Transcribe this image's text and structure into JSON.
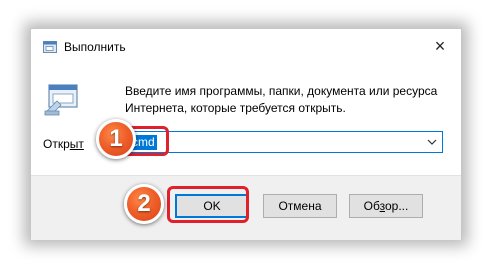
{
  "window": {
    "title": "Выполнить",
    "icon": "run-icon",
    "close_icon": "close-icon",
    "close_glyph": "×"
  },
  "body": {
    "icon": "run-dialog-icon",
    "description_line1": "Введите имя программы, папки, документа или ресурса",
    "description_line2": "Интернета, которые требуется открыть.",
    "open_label_prefix": "Откр",
    "open_label_rest": "ыт",
    "open_input": {
      "value": "cmd",
      "dropdown_icon": "chevron-down-icon"
    }
  },
  "buttons": {
    "ok": "OK",
    "cancel": "Отмена",
    "browse_prefix": "Об",
    "browse_underlined": "з",
    "browse_suffix": "ор..."
  },
  "annotations": {
    "step1": "1",
    "step2": "2",
    "highlight_color": "#e0202a",
    "badge_color": "#f0602a"
  },
  "colors": {
    "accent": "#0078d7",
    "footer_bg": "#f0f0f0"
  }
}
